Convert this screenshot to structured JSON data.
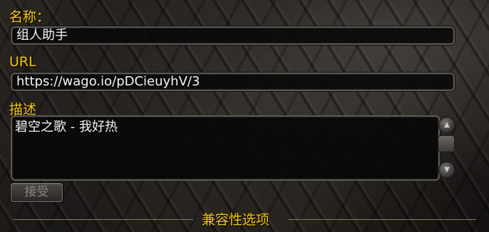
{
  "form": {
    "name_label": "名称：",
    "name_value": "组人助手",
    "url_label": "URL",
    "url_value": "https://wago.io/pDCieuyhV/3",
    "description_label": "描述",
    "description_value": "碧空之歌 - 我好热",
    "accept_button": "接受",
    "section_title": "兼容性选项"
  },
  "colors": {
    "label_gold": "#f2c70a",
    "field_bg": "#0a0a0a",
    "field_border": "#5a5652"
  },
  "icons": {
    "scroll_up": "scroll-up-icon",
    "scroll_down": "scroll-down-icon"
  }
}
